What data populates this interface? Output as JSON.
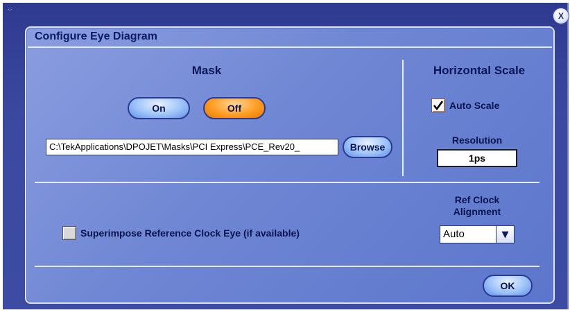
{
  "dialog": {
    "title": "Configure Eye Diagram",
    "close_label": "X"
  },
  "mask": {
    "heading": "Mask",
    "on_label": "On",
    "off_label": "Off",
    "selected": "Off",
    "path_value": "C:\\TekApplications\\DPOJET\\Masks\\PCI Express\\PCE_Rev20_",
    "browse_label": "Browse"
  },
  "horizontal_scale": {
    "heading": "Horizontal Scale",
    "auto_scale_label": "Auto Scale",
    "auto_scale_checked": true,
    "resolution_label": "Resolution",
    "resolution_value": "1ps"
  },
  "ref_clock": {
    "superimpose_label": "Superimpose Reference Clock Eye (if available)",
    "superimpose_checked": false,
    "alignment_label_line1": "Ref Clock",
    "alignment_label_line2": "Alignment",
    "alignment_value": "Auto",
    "dropdown_arrow": "▼"
  },
  "footer": {
    "ok_label": "OK"
  },
  "colors": {
    "outer_bg": "#3b4aa0",
    "dialog_bg": "#6e86d3",
    "off_active": "#ff9d22",
    "button_blue": "#9ec4f7",
    "text_dark": "#0a1450"
  }
}
